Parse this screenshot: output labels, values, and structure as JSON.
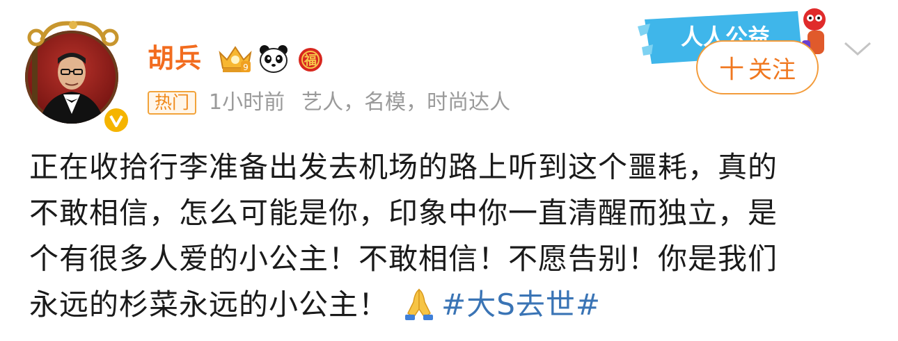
{
  "post": {
    "username": "胡兵",
    "hot_tag": "热门",
    "time": "1小时前",
    "user_tags": "艺人，名模，时尚达人",
    "follow_label": "关注",
    "follow_plus": "十",
    "charity_banner_text": "人人公益",
    "content_lines": [
      "正在收拾行李准备出发去机场的路上听到这个噩耗，真的",
      "不敢相信，怎么可能是你，印象中你一直清醒而独立，是",
      "个有很多人爱的小公主！不敢相信！不愿告别！你是我们",
      "永远的杉菜永远的小公主！"
    ],
    "hashtag": "#大S去世#",
    "icons": {
      "badge_1": "crown-vip-icon",
      "badge_2": "panda-icon",
      "badge_3": "fu-red-envelope-icon",
      "verified": "verified-v-icon",
      "pray": "folded-hands-icon",
      "more": "chevron-down-icon"
    },
    "colors": {
      "username": "#f26c1f",
      "hashtag": "#3a74b5",
      "meta_text": "#9a9a9a",
      "follow_border": "#f39b3a"
    }
  }
}
